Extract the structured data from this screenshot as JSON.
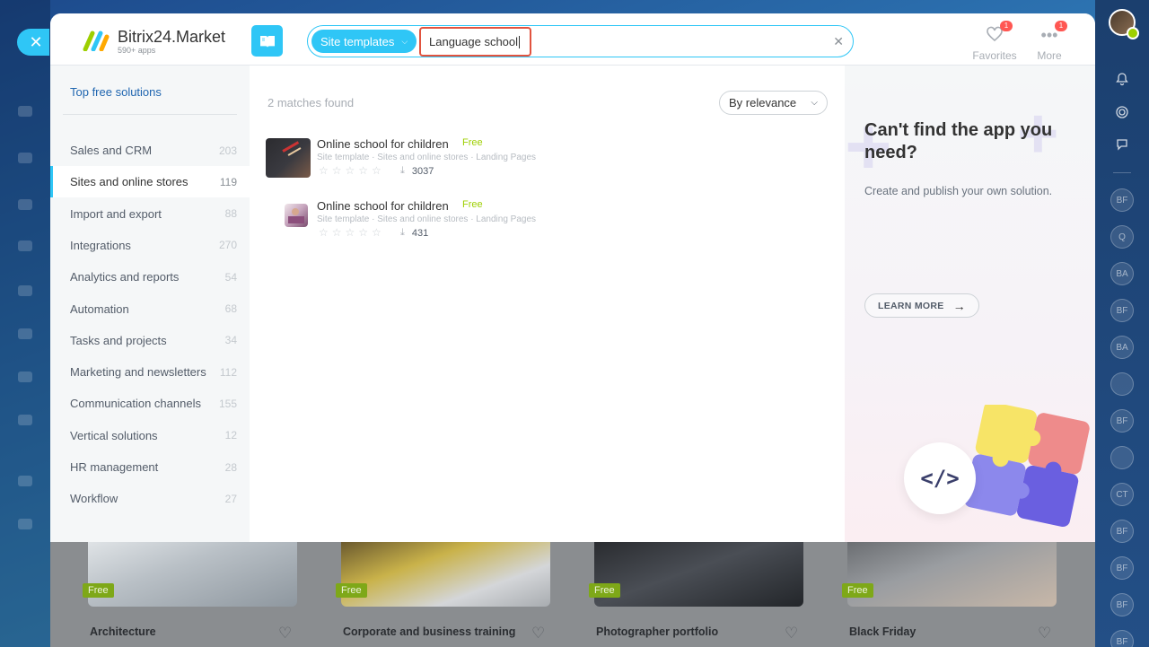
{
  "app": {
    "name": "Bitrix24.Market",
    "subtitle": "590+ apps"
  },
  "search": {
    "filter_chip": "Site templates",
    "query": "Language school",
    "clear_icon": "close-icon"
  },
  "top_actions": [
    {
      "label": "Favorites",
      "badge": "1",
      "icon": "heart-icon"
    },
    {
      "label": "More",
      "badge": "1",
      "icon": "more-dots-icon"
    }
  ],
  "sidebar": {
    "top_link": "Top free solutions",
    "items": [
      {
        "label": "Sales and CRM",
        "count": "203"
      },
      {
        "label": "Sites and online stores",
        "count": "119",
        "active": true
      },
      {
        "label": "Import and export",
        "count": "88"
      },
      {
        "label": "Integrations",
        "count": "270"
      },
      {
        "label": "Analytics and reports",
        "count": "54"
      },
      {
        "label": "Automation",
        "count": "68"
      },
      {
        "label": "Tasks and projects",
        "count": "34"
      },
      {
        "label": "Marketing and newsletters",
        "count": "112"
      },
      {
        "label": "Communication channels",
        "count": "155"
      },
      {
        "label": "Vertical solutions",
        "count": "12"
      },
      {
        "label": "HR management",
        "count": "28"
      },
      {
        "label": "Workflow",
        "count": "27"
      }
    ]
  },
  "results": {
    "count_text": "2 matches found",
    "sort_label": "By relevance",
    "items": [
      {
        "name": "Online school for children",
        "badge": "Free",
        "category": "Site template · Sites and online stores · Landing Pages",
        "rating": 0,
        "installs": "3037"
      },
      {
        "name": "Online school for children",
        "badge": "Free",
        "category": "Site template · Sites and online stores · Landing Pages",
        "rating": 0,
        "installs": "431"
      }
    ]
  },
  "promo": {
    "title": "Can't find the app you need?",
    "description": "Create and publish your own solution.",
    "button": "LEARN MORE"
  },
  "background_cards": [
    {
      "badge": "Free",
      "title": "Architecture"
    },
    {
      "badge": "Free",
      "title": "Corporate and business training"
    },
    {
      "badge": "Free",
      "title": "Photographer portfolio"
    },
    {
      "badge": "Free",
      "title": "Black Friday"
    }
  ],
  "right_bar": {
    "bubbles": [
      "BF",
      "Q",
      "BA",
      "BF",
      "BA",
      "",
      "BF",
      "",
      "CT",
      "BF",
      "BF",
      "BF",
      "BF"
    ]
  },
  "colors": {
    "accent": "#2fc6f6",
    "free_green": "#9dcf00",
    "badge_red": "#ff5752",
    "highlight_border": "#e1533f"
  }
}
